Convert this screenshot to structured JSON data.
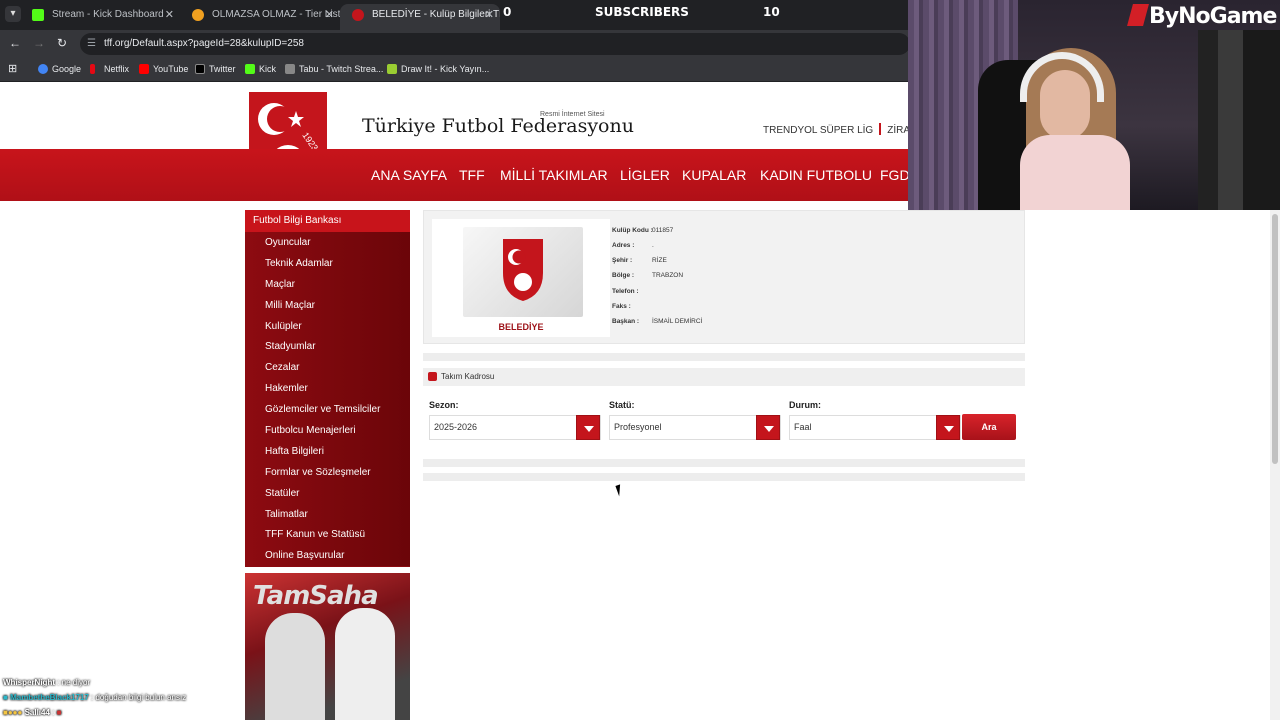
{
  "browser": {
    "tabs": [
      {
        "title": "Stream - Kick Dashboard",
        "favicon_color": "#53fc18"
      },
      {
        "title": "OLMAZSA OLMAZ - Tier List, K",
        "favicon_color": "#f0a020"
      },
      {
        "title": "BELEDİYE - Kulüp Bilgileri TFF",
        "favicon_color": "#c4151c"
      }
    ],
    "url": "tff.org/Default.aspx?pageId=28&kulupID=258",
    "bookmarks": [
      {
        "label": "Google",
        "color": "#4285f4"
      },
      {
        "label": "Netflix",
        "color": "#e50914"
      },
      {
        "label": "YouTube",
        "color": "#ff0000"
      },
      {
        "label": "Twitter",
        "color": "#000000"
      },
      {
        "label": "Kick",
        "color": "#53fc18"
      },
      {
        "label": "Tabu - Twitch Strea...",
        "color": "#888888"
      },
      {
        "label": "Draw It! - Kick Yayın...",
        "color": "#9acd32"
      }
    ]
  },
  "overlay": {
    "left_count": "0",
    "subscribers_label": "SUBSCRIBERS",
    "right_count": "10",
    "streamer_logo": "ByNoGame"
  },
  "site": {
    "brand": "Türkiye Futbol Federasyonu",
    "brand_sub": "Resmi İnternet Sitesi",
    "logo_year": "1923",
    "top_links": [
      "TRENDYOL SÜPER LİG",
      "ZİRAAT T"
    ],
    "nav": [
      "ANA SAYFA",
      "TFF",
      "MİLLİ TAKIMLAR",
      "LİGLER",
      "KUPALAR",
      "KADIN FUTBOLU",
      "FGD"
    ],
    "sidebar": {
      "title": "Futbol Bilgi Bankası",
      "items": [
        "Oyuncular",
        "Teknik Adamlar",
        "Maçlar",
        "Milli Maçlar",
        "Kulüpler",
        "Stadyumlar",
        "Cezalar",
        "Hakemler",
        "Gözlemciler ve Temsilciler",
        "Futbolcu Menajerleri",
        "Hafta Bilgileri",
        "Formlar ve Sözleşmeler",
        "Statüler",
        "Talimatlar",
        "TFF Kanun ve Statüsü",
        "Online Başvurular"
      ]
    },
    "promo_title": "TamSaha"
  },
  "club": {
    "name": "BELEDİYE",
    "fields": [
      {
        "label": "Kulüp Kodu :",
        "value": "011857"
      },
      {
        "label": "Adres :",
        "value": "."
      },
      {
        "label": "Şehir :",
        "value": "RİZE"
      },
      {
        "label": "Bölge :",
        "value": "TRABZON"
      },
      {
        "label": "Telefon :",
        "value": ""
      },
      {
        "label": "Faks :",
        "value": ""
      },
      {
        "label": "Başkan :",
        "value": "İSMAİL DEMİRCİ"
      }
    ]
  },
  "squad": {
    "title": "Takım Kadrosu",
    "season_label": "Sezon:",
    "season_value": "2025-2026",
    "status_label": "Statü:",
    "status_value": "Profesyonel",
    "state_label": "Durum:",
    "state_value": "Faal",
    "search_button": "Ara"
  },
  "chat": [
    {
      "user": "WhisperNight",
      "msg": ": ne diyor"
    },
    {
      "user": "MambetheBlack1717",
      "msg": ": doğudan bilgi bulun ansız"
    },
    {
      "user": "Sallı44",
      "msg": ":"
    }
  ]
}
